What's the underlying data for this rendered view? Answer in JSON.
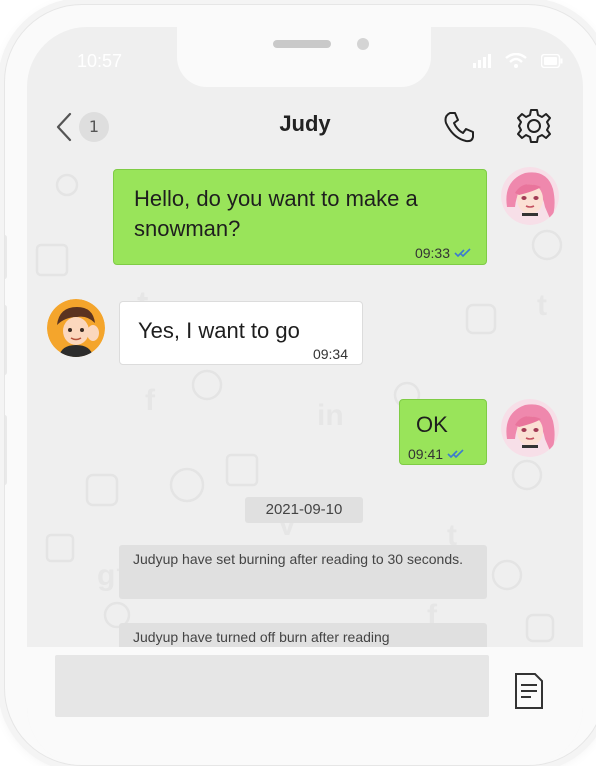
{
  "status_bar": {
    "time": "10:57"
  },
  "header": {
    "title": "Judy",
    "unread_count": "1",
    "icons": [
      "back-chevron-icon",
      "phone-icon",
      "gear-icon"
    ]
  },
  "messages": [
    {
      "direction": "out",
      "text": "Hello, do you want to make a snowman?",
      "time": "09:33",
      "read": true
    },
    {
      "direction": "in",
      "text": "Yes, I want to go",
      "time": "09:34"
    },
    {
      "direction": "out",
      "text": "OK",
      "time": "09:41",
      "read": true
    }
  ],
  "date_divider": "2021-09-10",
  "system_notes": [
    "Judyup have set burning after reading to 30 seconds.",
    "Judyup have turned off burn after reading"
  ],
  "input": {
    "placeholder": "",
    "icons": [
      "document-icon"
    ]
  },
  "colors": {
    "outgoing_bubble": "#99e45a",
    "incoming_bubble": "#ffffff",
    "read_check": "#3c7bd0",
    "chip": "#e0e0e0"
  }
}
